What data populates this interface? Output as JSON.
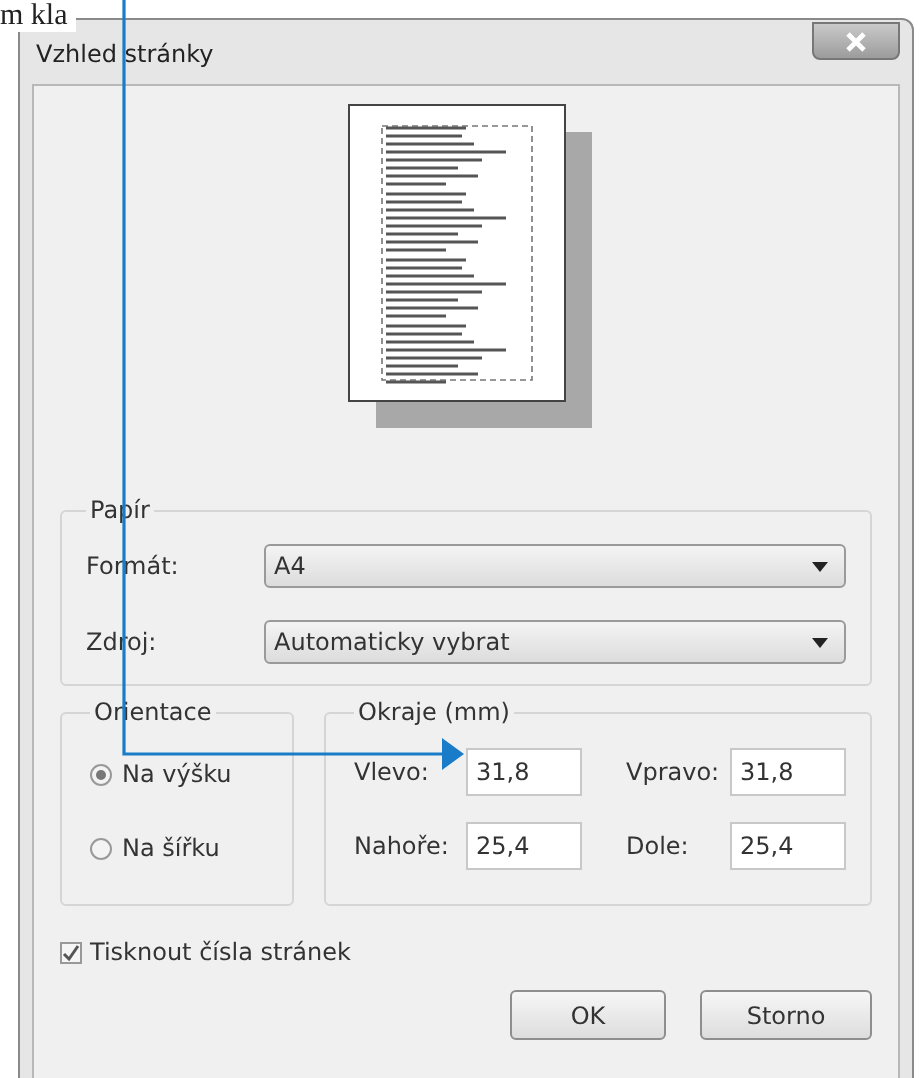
{
  "callout": {
    "text": "m kla"
  },
  "window": {
    "title": "Vzhled stránky"
  },
  "paper": {
    "title": "Papír",
    "fields": [
      {
        "label": "Formát:",
        "value": "A4"
      },
      {
        "label": "Zdroj:",
        "value": "Automaticky vybrat"
      }
    ]
  },
  "orientation": {
    "title": "Orientace",
    "options": [
      {
        "label": "Na výšku",
        "selected": true
      },
      {
        "label": "Na šířku",
        "selected": false
      }
    ]
  },
  "margins": {
    "title": "Okraje (mm)",
    "fields": [
      {
        "label": "Vlevo:",
        "value": "31,8"
      },
      {
        "label": "Vpravo:",
        "value": "31,8"
      },
      {
        "label": "Nahoře:",
        "value": "25,4"
      },
      {
        "label": "Dole:",
        "value": "25,4"
      }
    ]
  },
  "print_page_numbers": {
    "label": "Tisknout čísla stránek",
    "checked": true
  },
  "buttons": [
    "OK",
    "Storno"
  ]
}
